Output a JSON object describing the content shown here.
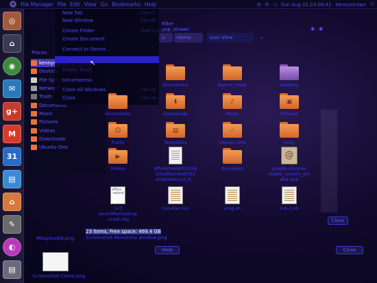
{
  "panel": {
    "close": "×",
    "menus": [
      "File Manager",
      "File",
      "Edit",
      "View",
      "Go",
      "Bookmarks",
      "Help"
    ],
    "clock": "Sun Aug 21 23:08:41",
    "user": "kennystrawn"
  },
  "file_menu": {
    "items": [
      {
        "label": "New Tab",
        "shortcut": "Ctrl+T"
      },
      {
        "label": "New Window",
        "shortcut": "Ctrl+N"
      },
      {
        "label": "Create Folder",
        "shortcut": "Shift+Ctrl+N"
      },
      {
        "label": "Create Document",
        "shortcut": ""
      },
      {
        "label": "Connect to Server...",
        "shortcut": ""
      },
      {
        "label": "",
        "shortcut": ""
      },
      {
        "label": "Empty Trash",
        "shortcut": ""
      },
      {
        "label": "Uncompress",
        "shortcut": ""
      },
      {
        "label": "Close All Windows",
        "shortcut": "Ctrl+Q"
      },
      {
        "label": "Close",
        "shortcut": "Ctrl+W"
      }
    ]
  },
  "places": {
    "header": "Places",
    "items": [
      "kennystrawn",
      "Desktop",
      "File System",
      "Network",
      "Trash",
      "Documents",
      "Music",
      "Pictures",
      "Videos",
      "Downloads",
      "Ubuntu One"
    ]
  },
  "toolbar": {
    "back": "Back",
    "location": "Home",
    "view": "Icon View",
    "tabs": [
      "Filter",
      "yap_strawn"
    ]
  },
  "files": [
    {
      "name": "Animations",
      "type": "folder",
      "glyph": ""
    },
    {
      "name": "Bamm_loops",
      "type": "folder",
      "glyph": ""
    },
    {
      "name": "Desktop",
      "type": "folder-desktop",
      "glyph": ""
    },
    {
      "name": "Documents",
      "type": "folder",
      "glyph": ""
    },
    {
      "name": "Downloads",
      "type": "folder",
      "glyph": "⬇"
    },
    {
      "name": "Music",
      "type": "folder",
      "glyph": "♪"
    },
    {
      "name": "Pictures",
      "type": "folder",
      "glyph": "▣"
    },
    {
      "name": "Public",
      "type": "folder",
      "glyph": "☺"
    },
    {
      "name": "Templates",
      "type": "folder",
      "glyph": "▤"
    },
    {
      "name": "Ubuntu One",
      "type": "folder",
      "glyph": "✓"
    },
    {
      "name": "unity",
      "type": "folder",
      "glyph": ""
    },
    {
      "name": "Videos",
      "type": "folder",
      "glyph": "▶"
    },
    {
      "name": "8ffaddfa4d6f01d16 a3a3f8a16ed3f32 e0db164c1ce_tt...",
      "type": "doc",
      "glyph": ""
    },
    {
      "name": "Examples",
      "type": "folder",
      "glyph": ""
    },
    {
      "name": "google-chrome-stable_current_amd64.deb",
      "type": "pkg",
      "glyph": "@"
    },
    {
      "name": "123 recordMyDesktop-crash.log",
      "type": "text",
      "glyph": ""
    },
    {
      "name": "installer.run",
      "type": "sh",
      "glyph": ""
    },
    {
      "name": "prog.sh",
      "type": "sh",
      "glyph": ""
    },
    {
      "name": "run-1.sh",
      "type": "sh",
      "glyph": ""
    }
  ],
  "status": {
    "text": "23 items, Free space: 469.4 GB",
    "second": "Screenshot-Remmina window.png"
  },
  "desktop": {
    "items": [
      "Mkayonz66.png",
      "Screenshot-Clone.png"
    ]
  },
  "buttons": {
    "help": "Help",
    "close": "Close",
    "right_top": "Close"
  },
  "launcher": {
    "items": [
      {
        "name": "dash",
        "glyph": "◎",
        "color": "#a25a3a"
      },
      {
        "name": "files",
        "glyph": "⌂",
        "color": "#9c4a2a"
      },
      {
        "name": "chrome",
        "glyph": "◉",
        "color": "#3c8a3a"
      },
      {
        "name": "photo",
        "glyph": "✉",
        "color": "#2a7aba"
      },
      {
        "name": "google-plus",
        "glyph": "g+",
        "color": "#c83a2a"
      },
      {
        "name": "gmail",
        "glyph": "M",
        "color": "#d83a2a"
      },
      {
        "name": "calendar",
        "glyph": "31",
        "color": "#2a6ac8"
      },
      {
        "name": "docs",
        "glyph": "▤",
        "color": "#3a8ad8"
      },
      {
        "name": "home-folder",
        "glyph": "⌂",
        "color": "#d8783a"
      },
      {
        "name": "text-editor",
        "glyph": "✎",
        "color": "#6a6a6a"
      },
      {
        "name": "color",
        "glyph": "◐",
        "color": "#b83aba"
      },
      {
        "name": "printer",
        "glyph": "▤",
        "color": "#6a6a7a"
      }
    ]
  }
}
